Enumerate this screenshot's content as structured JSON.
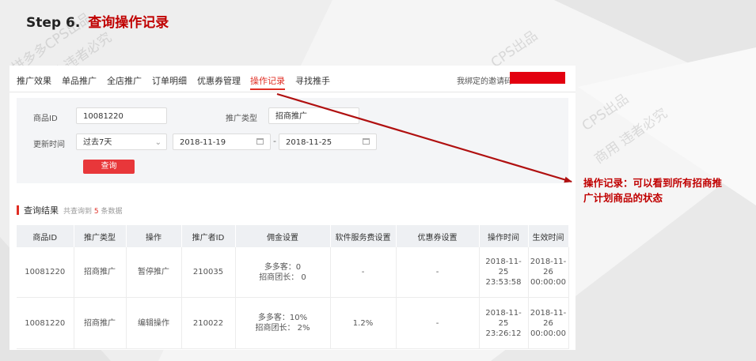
{
  "step": {
    "number": "Step 6.",
    "title": "查询操作记录"
  },
  "nav": {
    "tabs": [
      {
        "label": "推广效果",
        "active": false
      },
      {
        "label": "单品推广",
        "active": false
      },
      {
        "label": "全店推广",
        "active": false
      },
      {
        "label": "订单明细",
        "active": false
      },
      {
        "label": "优惠券管理",
        "active": false
      },
      {
        "label": "操作记录",
        "active": true
      },
      {
        "label": "寻找推手",
        "active": false
      }
    ],
    "invite_label": "我绑定的邀请码",
    "invite_tail": " "
  },
  "filter": {
    "goods_id_label": "商品ID",
    "goods_id_value": "10081220",
    "promo_type_label": "推广类型",
    "promo_type_value": "招商推广",
    "update_time_label": "更新时间",
    "period_value": "过去7天",
    "date_start": "2018-11-19",
    "date_separator": "-",
    "date_end": "2018-11-25",
    "query_button": "查询"
  },
  "result": {
    "title": "查询结果",
    "count_prefix": "共查询到",
    "count_value": "5",
    "count_suffix": "条数据"
  },
  "table": {
    "headers": [
      "商品ID",
      "推广类型",
      "操作",
      "推广者ID",
      "佣金设置",
      "软件服务费设置",
      "优惠券设置",
      "操作时间",
      "生效时间"
    ],
    "rows": [
      {
        "goods_id": "10081220",
        "type": "招商推广",
        "action": "暂停推广",
        "promoter_id": "210035",
        "commission_line1": "多多客：0",
        "commission_line2": "招商团长： 0",
        "service_fee": "-",
        "coupon": "-",
        "op_time": [
          "2018-11-",
          "25",
          "23:53:58"
        ],
        "eff_time": [
          "2018-11-",
          "26",
          "00:00:00"
        ]
      },
      {
        "goods_id": "10081220",
        "type": "招商推广",
        "action": "编辑操作",
        "promoter_id": "210022",
        "commission_line1": "多多客：10%",
        "commission_line2": "招商团长： 2%",
        "service_fee": "1.2%",
        "coupon": "-",
        "op_time": [
          "2018-11-",
          "25",
          "23:26:12"
        ],
        "eff_time": [
          "2018-11-",
          "26",
          "00:00:00"
        ]
      }
    ]
  },
  "callout": {
    "line1": "操作记录：可以看到所有招商推",
    "line2": "广计划商品的状态"
  },
  "watermarks": [
    "拼多多CPS出品",
    "商用 违者必究",
    "CPS出品",
    "CPS出品",
    "商用 违者必究"
  ],
  "colors": {
    "accent": "#e02e24",
    "annotation": "#c00000",
    "redaction": "#e3000f",
    "arrow": "#b01010"
  }
}
